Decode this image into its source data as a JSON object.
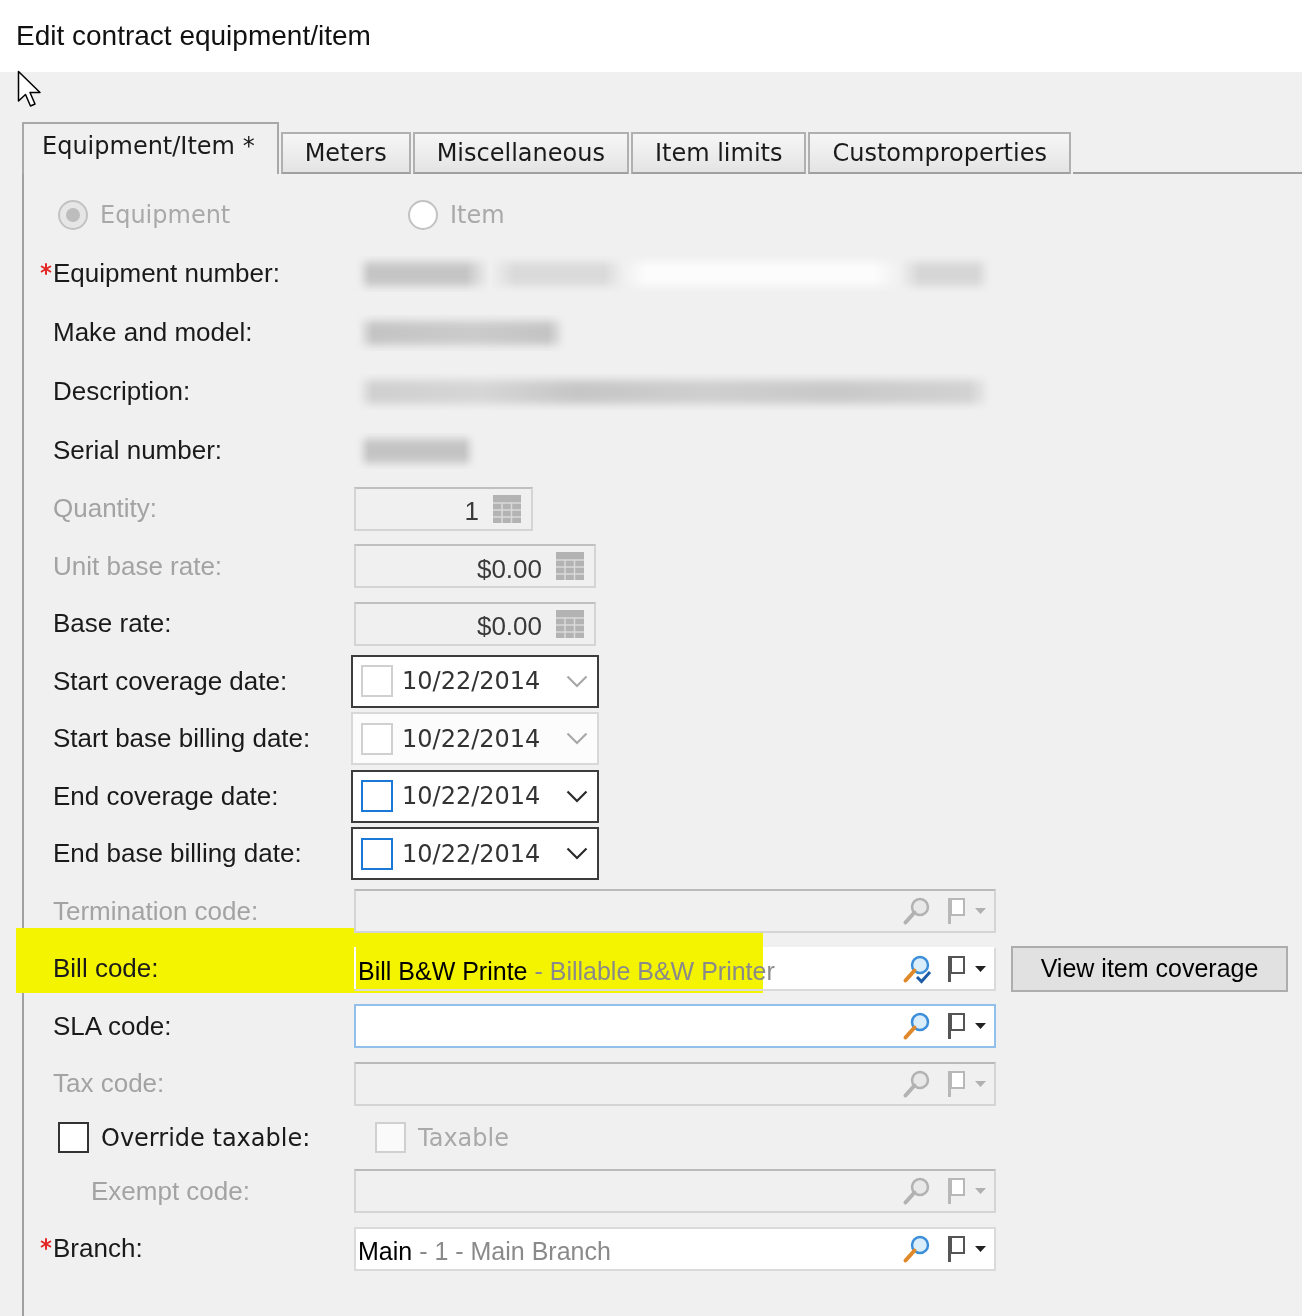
{
  "window": {
    "title": "Edit contract equipment/item"
  },
  "tabs": [
    {
      "label": "Equipment/Item *",
      "selected": true
    },
    {
      "label": "Meters",
      "selected": false
    },
    {
      "label": "Miscellaneous",
      "selected": false
    },
    {
      "label": "Item limits",
      "selected": false
    },
    {
      "label": "Customproperties",
      "selected": false
    }
  ],
  "record_type": [
    {
      "label": "Equipment",
      "selected": true,
      "disabled": true
    },
    {
      "label": "Item",
      "selected": false,
      "disabled": true
    }
  ],
  "fields": [
    {
      "kind": "redacted",
      "label": "Equipment number:",
      "required": true,
      "disabled": false
    },
    {
      "kind": "redacted",
      "label": "Make and model:",
      "required": false,
      "disabled": false
    },
    {
      "kind": "redacted",
      "label": "Description:",
      "required": false,
      "disabled": false
    },
    {
      "kind": "redacted",
      "label": "Serial number:",
      "required": false,
      "disabled": false
    },
    {
      "kind": "number",
      "label": "Quantity:",
      "value": "1",
      "required": false,
      "disabled": true
    },
    {
      "kind": "money",
      "label": "Unit base rate:",
      "value": "$0.00",
      "required": false,
      "disabled": true
    },
    {
      "kind": "money",
      "label": "Base rate:",
      "value": "$0.00",
      "required": false,
      "disabled": false
    },
    {
      "kind": "date",
      "label": "Start coverage date:",
      "value": "10/22/2014",
      "checked": false,
      "outlined": true,
      "focused": false,
      "required": false,
      "disabled": false
    },
    {
      "kind": "date",
      "label": "Start base billing date:",
      "value": "10/22/2014",
      "checked": false,
      "outlined": false,
      "focused": false,
      "required": false,
      "disabled": false
    },
    {
      "kind": "date",
      "label": "End coverage date:",
      "value": "10/22/2014",
      "checked": false,
      "outlined": true,
      "focused": true,
      "required": false,
      "disabled": false
    },
    {
      "kind": "date",
      "label": "End base billing date:",
      "value": "10/22/2014",
      "checked": false,
      "outlined": true,
      "focused": true,
      "required": false,
      "disabled": false
    },
    {
      "kind": "lookup",
      "label": "Termination code:",
      "required": false,
      "disabled": true,
      "focused": false,
      "validated": false,
      "highlighted": false
    },
    {
      "kind": "lookup",
      "label": "Bill code:",
      "value": "Bill B&W Printe",
      "detail": "- Billable B&W Printer",
      "button": "View item coverage",
      "required": false,
      "disabled": false,
      "focused": false,
      "validated": true,
      "highlighted": true
    },
    {
      "kind": "lookup",
      "label": "SLA code:",
      "required": false,
      "disabled": false,
      "focused": true,
      "validated": false,
      "highlighted": false
    },
    {
      "kind": "lookup",
      "label": "Tax code:",
      "required": false,
      "disabled": true,
      "focused": false,
      "validated": false,
      "highlighted": false
    },
    {
      "kind": "override",
      "label": "Override taxable:",
      "checked": false,
      "required": false,
      "disabled": false,
      "option": {
        "label": "Taxable",
        "checked": false,
        "disabled": true
      },
      "children": [
        {
          "kind": "lookup",
          "label": "Exempt code:",
          "required": false,
          "disabled": true,
          "focused": false,
          "validated": false,
          "highlighted": false
        }
      ]
    },
    {
      "kind": "lookup",
      "label": "Branch:",
      "value": "Main",
      "detail": "- 1 - Main Branch",
      "required": true,
      "disabled": false,
      "focused": false,
      "validated": false,
      "highlighted": false
    }
  ]
}
